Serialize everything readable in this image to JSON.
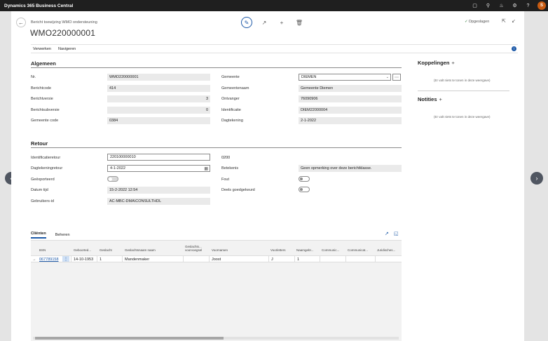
{
  "app": {
    "title": "Dynamics 365 Business Central",
    "user_initial": "S"
  },
  "topbar_icons": [
    "document-icon",
    "search-icon",
    "bell-icon",
    "gear-icon",
    "help-icon"
  ],
  "page": {
    "breadcrumb": "Bericht toewijzing WMO ondersteuning",
    "title": "WMO220000001",
    "saved_label": "Opgeslagen",
    "menu": [
      "Verwerken",
      "Navigeren"
    ]
  },
  "algemeen": {
    "title": "Algemeen",
    "nr": {
      "label": "Nr.",
      "value": "WMO220000001"
    },
    "berichtcode": {
      "label": "Berichtcode",
      "value": "414"
    },
    "berichtversie": {
      "label": "Berichtversie",
      "value": "3"
    },
    "berichtsubversie": {
      "label": "Berichtsubversie",
      "value": "0"
    },
    "gemeente_code": {
      "label": "Gemeente code",
      "value": "0384"
    },
    "gemeente": {
      "label": "Gemeente",
      "value": "DIEMEN"
    },
    "gemeentenaam": {
      "label": "Gemeentenaam",
      "value": "Gemeente Diemen"
    },
    "ontvanger": {
      "label": "Ontvanger",
      "value": "76090906"
    },
    "identificatie": {
      "label": "Identificatie",
      "value": "DIEM22000004"
    },
    "dagtekening": {
      "label": "Dagtekening",
      "value": "2-1-2022"
    }
  },
  "retour": {
    "title": "Retour",
    "identificatieretour": {
      "label": "Identificatieretour",
      "value": "220100000010"
    },
    "dagtekeningretour": {
      "label": "Dagtekeningretour",
      "value": "4-1-2022"
    },
    "geexporteerd": {
      "label": "Geëxporteerd",
      "value": true
    },
    "datum_tijd": {
      "label": "Datum tijd",
      "value": "15-2-2022 12:54"
    },
    "gebruikers_id": {
      "label": "Gebruikers-id",
      "value": "AC-MBC-DMA\\CONSULTHDL"
    },
    "code_value": "0200",
    "betekenis": {
      "label": "Betekenis",
      "value": "Geen opmerking over deze berichtklasse."
    },
    "fout": {
      "label": "Fout",
      "value": false
    },
    "deels_goedgekeurd": {
      "label": "Deels goedgekeurd",
      "value": false
    }
  },
  "factbox": {
    "koppelingen": {
      "title": "Koppelingen",
      "empty": "(Er valt niets te tonen in deze weergave)"
    },
    "notities": {
      "title": "Notities",
      "empty": "(Er valt niets te tonen in deze weergave)"
    }
  },
  "clienten": {
    "tabs": [
      "Cliënten",
      "Beheren"
    ],
    "columns": [
      "BSN",
      "Geboorted...",
      "Geslacht",
      "Geslachtsnaam naam",
      "Geslachts... voorvoegsel",
      "Voornamen",
      "Voorletters",
      "Naamgebr...",
      "Communic...",
      "Communicat...",
      "Juridisches..."
    ],
    "rows": [
      {
        "bsn": "067789158",
        "geboortedatum": "14-10-1953",
        "geslacht": "1",
        "geslachtsnaam": "Mandenmaker",
        "voorvoegsel": "",
        "voornamen": "Joost",
        "voorletters": "J",
        "naamgebruik": "1",
        "communicatie1": "",
        "communicatie2": "",
        "juridisch": ""
      }
    ]
  }
}
